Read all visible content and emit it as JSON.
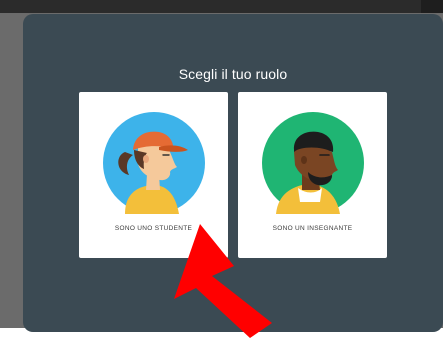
{
  "dialog": {
    "title": "Scegli il tuo ruolo",
    "roles": [
      {
        "label": "SONO UNO STUDENTE",
        "avatar_bg": "#3db3ea",
        "icon": "student-avatar-icon"
      },
      {
        "label": "SONO UN INSEGNANTE",
        "avatar_bg": "#1fb573",
        "icon": "teacher-avatar-icon"
      }
    ]
  },
  "colors": {
    "dialog_bg": "#3b4a53",
    "overlay": "#6b6b6b",
    "arrow": "#ff0000"
  },
  "annotation": {
    "icon": "red-arrow-icon"
  }
}
